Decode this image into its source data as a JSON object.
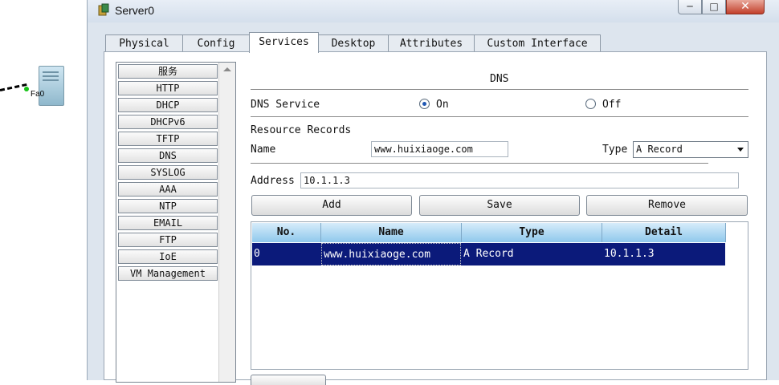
{
  "canvas": {
    "port_label": "Fa0"
  },
  "window": {
    "title": "Server0"
  },
  "tabs": [
    {
      "label": "Physical",
      "active": false
    },
    {
      "label": "Config",
      "active": false
    },
    {
      "label": "Services",
      "active": true
    },
    {
      "label": "Desktop",
      "active": false
    },
    {
      "label": "Attributes",
      "active": false
    },
    {
      "label": "Custom Interface",
      "active": false
    }
  ],
  "services": [
    "服务",
    "HTTP",
    "DHCP",
    "DHCPv6",
    "TFTP",
    "DNS",
    "SYSLOG",
    "AAA",
    "NTP",
    "EMAIL",
    "FTP",
    "IoE",
    "VM Management"
  ],
  "dns": {
    "title": "DNS",
    "service_label": "DNS Service",
    "on_label": "On",
    "off_label": "Off",
    "service_state": "On",
    "records_heading": "Resource Records",
    "name_label": "Name",
    "name_value": "www.huixiaoge.com",
    "type_label": "Type",
    "type_value": "A Record",
    "address_label": "Address",
    "address_value": "10.1.1.3",
    "add_button": "Add",
    "save_button": "Save",
    "remove_button": "Remove"
  },
  "table": {
    "headers": [
      "No.",
      "Name",
      "Type",
      "Detail"
    ],
    "rows": [
      {
        "no": "0",
        "name": "www.huixiaoge.com",
        "type": "A Record",
        "detail": "10.1.1.3"
      }
    ]
  },
  "colors": {
    "header_grad_top": "#d6ecfa",
    "header_grad_bottom": "#8fc8ec",
    "selected_row": "#0b1a7a",
    "radio_on": "#1f57b3"
  }
}
